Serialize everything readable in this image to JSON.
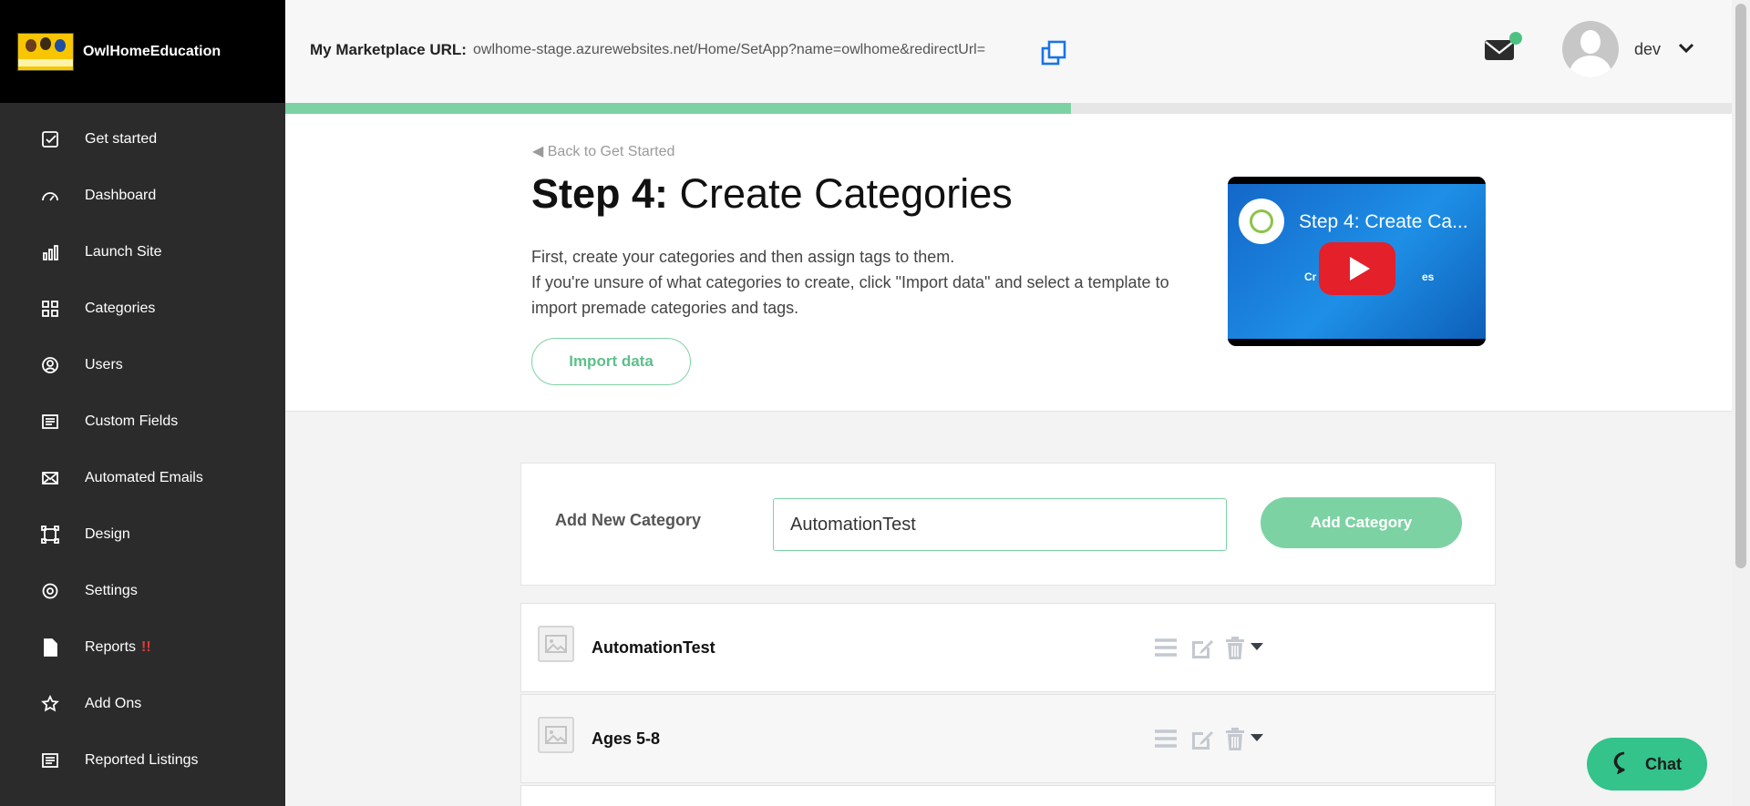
{
  "brand": {
    "name": "OwlHomeEducation"
  },
  "sidebar": {
    "items": [
      {
        "label": "Get started",
        "icon": "checkbox-icon"
      },
      {
        "label": "Dashboard",
        "icon": "gauge-icon"
      },
      {
        "label": "Launch Site",
        "icon": "bar-chart-icon"
      },
      {
        "label": "Categories",
        "icon": "grid-icon"
      },
      {
        "label": "Users",
        "icon": "user-circle-icon"
      },
      {
        "label": "Custom Fields",
        "icon": "list-icon"
      },
      {
        "label": "Automated Emails",
        "icon": "envelope-icon"
      },
      {
        "label": "Design",
        "icon": "frame-icon"
      },
      {
        "label": "Settings",
        "icon": "gear-icon"
      },
      {
        "label": "Reports",
        "icon": "document-icon",
        "alert": "!!"
      },
      {
        "label": "Add Ons",
        "icon": "star-icon"
      },
      {
        "label": "Reported Listings",
        "icon": "list-icon"
      }
    ]
  },
  "header": {
    "marketplace_label": "My Marketplace URL:",
    "marketplace_url": "owlhome-stage.azurewebsites.net/Home/SetApp?name=owlhome&redirectUrl=",
    "username": "dev",
    "notification_color": "#4cc282"
  },
  "progress": {
    "fraction": 0.543,
    "color": "#7dd2a4"
  },
  "intro": {
    "back_link": "◀ Back to Get Started",
    "title_step": "Step 4:",
    "title_text": " Create Categories",
    "desc_line1": "First, create your categories and then assign tags to them.",
    "desc_line2": "If you're unsure of what categories to create, click \"Import data\" and select a template to import premade categories and tags.",
    "import_button": "Import data",
    "video": {
      "title": "Step 4: Create Ca...",
      "sub_left": "Cr",
      "sub_right": "es"
    }
  },
  "add_category": {
    "label": "Add New Category",
    "input_value": "AutomationTest",
    "button": "Add Category"
  },
  "categories": [
    {
      "name": "AutomationTest"
    },
    {
      "name": "Ages 5-8"
    }
  ],
  "chat": {
    "label": "Chat",
    "color": "#33c38b"
  },
  "colors": {
    "accent": "#7dd2a4",
    "sidebar": "#2b2b2b"
  }
}
